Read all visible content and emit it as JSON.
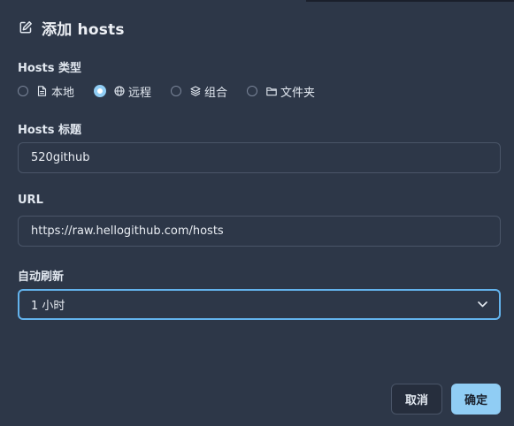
{
  "dialog": {
    "title": "添加 hosts",
    "title_icon": "edit-icon"
  },
  "type_field": {
    "label": "Hosts 类型",
    "options": [
      {
        "label": "本地",
        "icon": "file-icon",
        "checked": false
      },
      {
        "label": "远程",
        "icon": "globe-icon",
        "checked": true
      },
      {
        "label": "组合",
        "icon": "layers-icon",
        "checked": false
      },
      {
        "label": "文件夹",
        "icon": "folder-icon",
        "checked": false
      }
    ]
  },
  "title_field": {
    "label": "Hosts 标题",
    "value": "520github"
  },
  "url_field": {
    "label": "URL",
    "value": "https://raw.hellogithub.com/hosts"
  },
  "refresh_field": {
    "label": "自动刷新",
    "selected": "1 小时"
  },
  "buttons": {
    "cancel": "取消",
    "confirm": "确定"
  },
  "colors": {
    "background": "#2d3748",
    "accent": "#90cdf4",
    "focus_border": "#63b3ed"
  }
}
